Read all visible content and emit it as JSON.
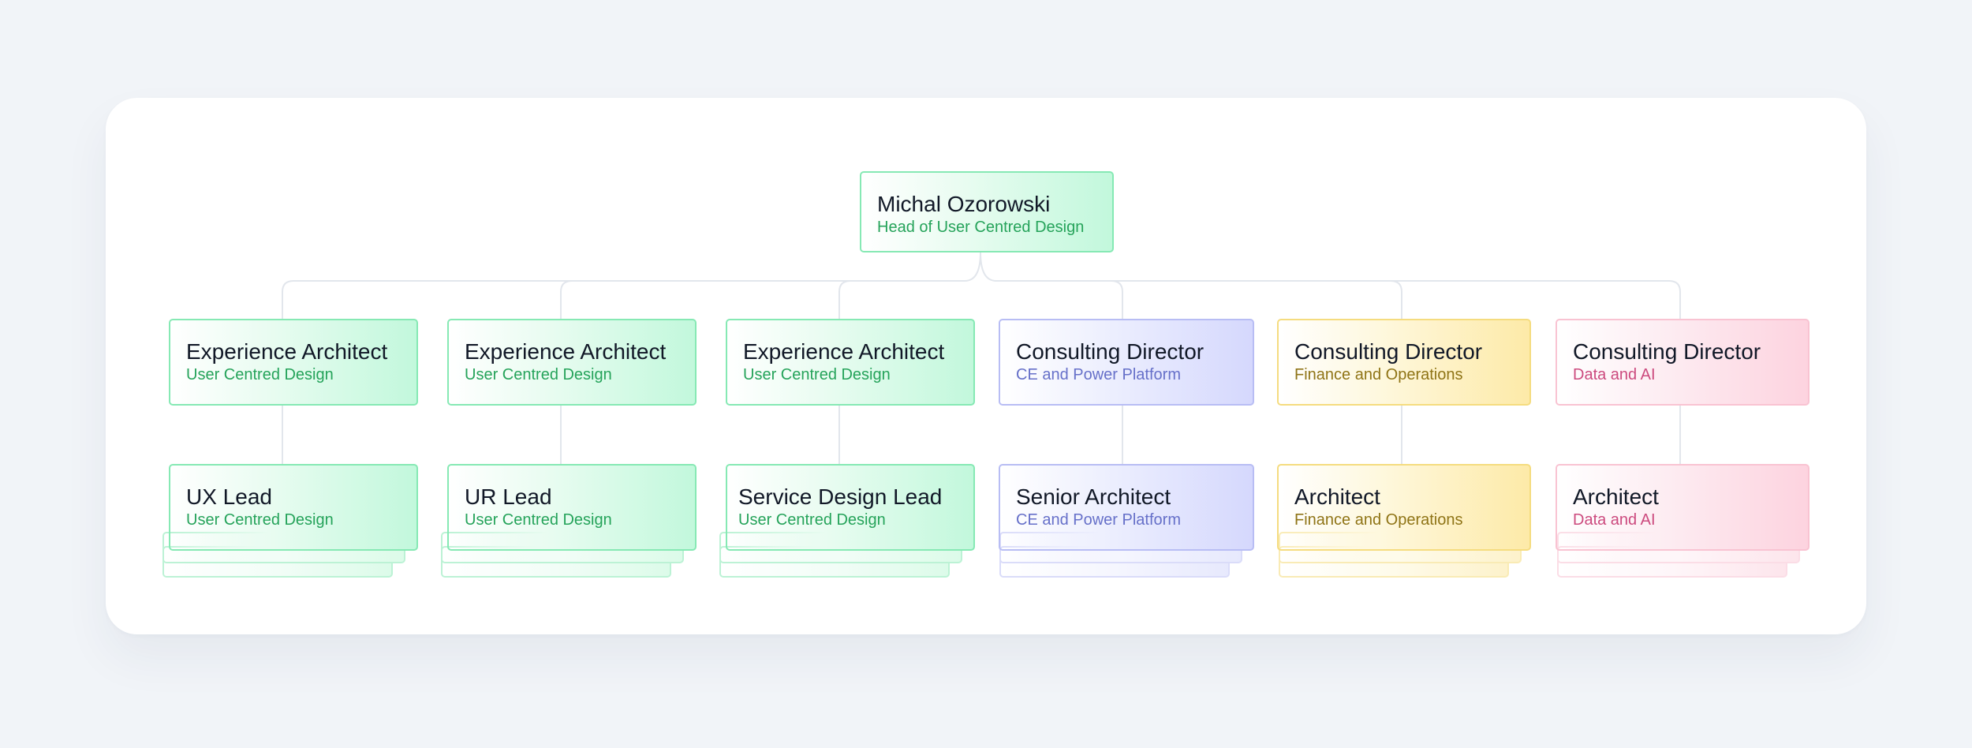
{
  "head": {
    "name": "Michal Ozorowski",
    "role": "Head of User Centred Design"
  },
  "columns": [
    {
      "title": "Experience Architect",
      "unit": "User Centred Design",
      "lead_title": "UX Lead",
      "lead_unit": "User Centred Design"
    },
    {
      "title": "Experience Architect",
      "unit": "User Centred Design",
      "lead_title": "UR Lead",
      "lead_unit": "User Centred Design"
    },
    {
      "title": "Experience Architect",
      "unit": "User Centred Design",
      "lead_title": "Service Design Lead",
      "lead_unit": "User Centred Design"
    },
    {
      "title": "Consulting Director",
      "unit": "CE and Power Platform",
      "lead_title": "Senior Architect",
      "lead_unit": "CE and Power Platform"
    },
    {
      "title": "Consulting Director",
      "unit": "Finance and Operations",
      "lead_title": "Architect",
      "lead_unit": "Finance and Operations"
    },
    {
      "title": "Consulting Director",
      "unit": "Data and AI",
      "lead_title": "Architect",
      "lead_unit": "Data and AI"
    }
  ],
  "colors": {
    "ucd_green": "#25a35a",
    "ce_blue": "#6670c9",
    "fo_yellow": "#8f7416",
    "dai_pink": "#cc4a7e",
    "connector": "#e2e6ec"
  }
}
